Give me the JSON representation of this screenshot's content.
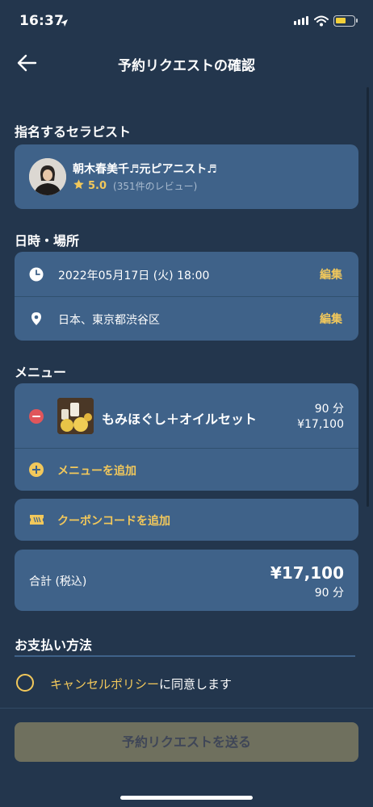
{
  "status_bar": {
    "time": "16:37"
  },
  "header": {
    "title": "予約リクエストの確認"
  },
  "therapist_section": {
    "title": "指名するセラピスト",
    "name": "朝木春美千♬元ピアニスト♬",
    "rating": "5.0",
    "reviews": "(351件のレビュー)"
  },
  "datetime_section": {
    "title": "日時・場所",
    "datetime": "2022年05月17日 (火) 18:00",
    "location": "日本、東京都渋谷区",
    "edit_label": "編集"
  },
  "menu_section": {
    "title": "メニュー",
    "items": [
      {
        "name": "もみほぐし＋オイルセット",
        "duration": "90 分",
        "price": "¥17,100"
      }
    ],
    "add_label": "メニューを追加"
  },
  "coupon": {
    "label": "クーポンコードを追加"
  },
  "total": {
    "label": "合計 (税込)",
    "price": "¥17,100",
    "duration": "90 分"
  },
  "payment_section": {
    "title": "お支払い方法"
  },
  "policy": {
    "link_text": "キャンセルポリシー",
    "suffix": "に同意します"
  },
  "submit": {
    "label": "予約リクエストを送る"
  },
  "colors": {
    "background": "#23364d",
    "card": "#3f6289",
    "accent": "#f2c85b",
    "danger": "#e0565b"
  }
}
